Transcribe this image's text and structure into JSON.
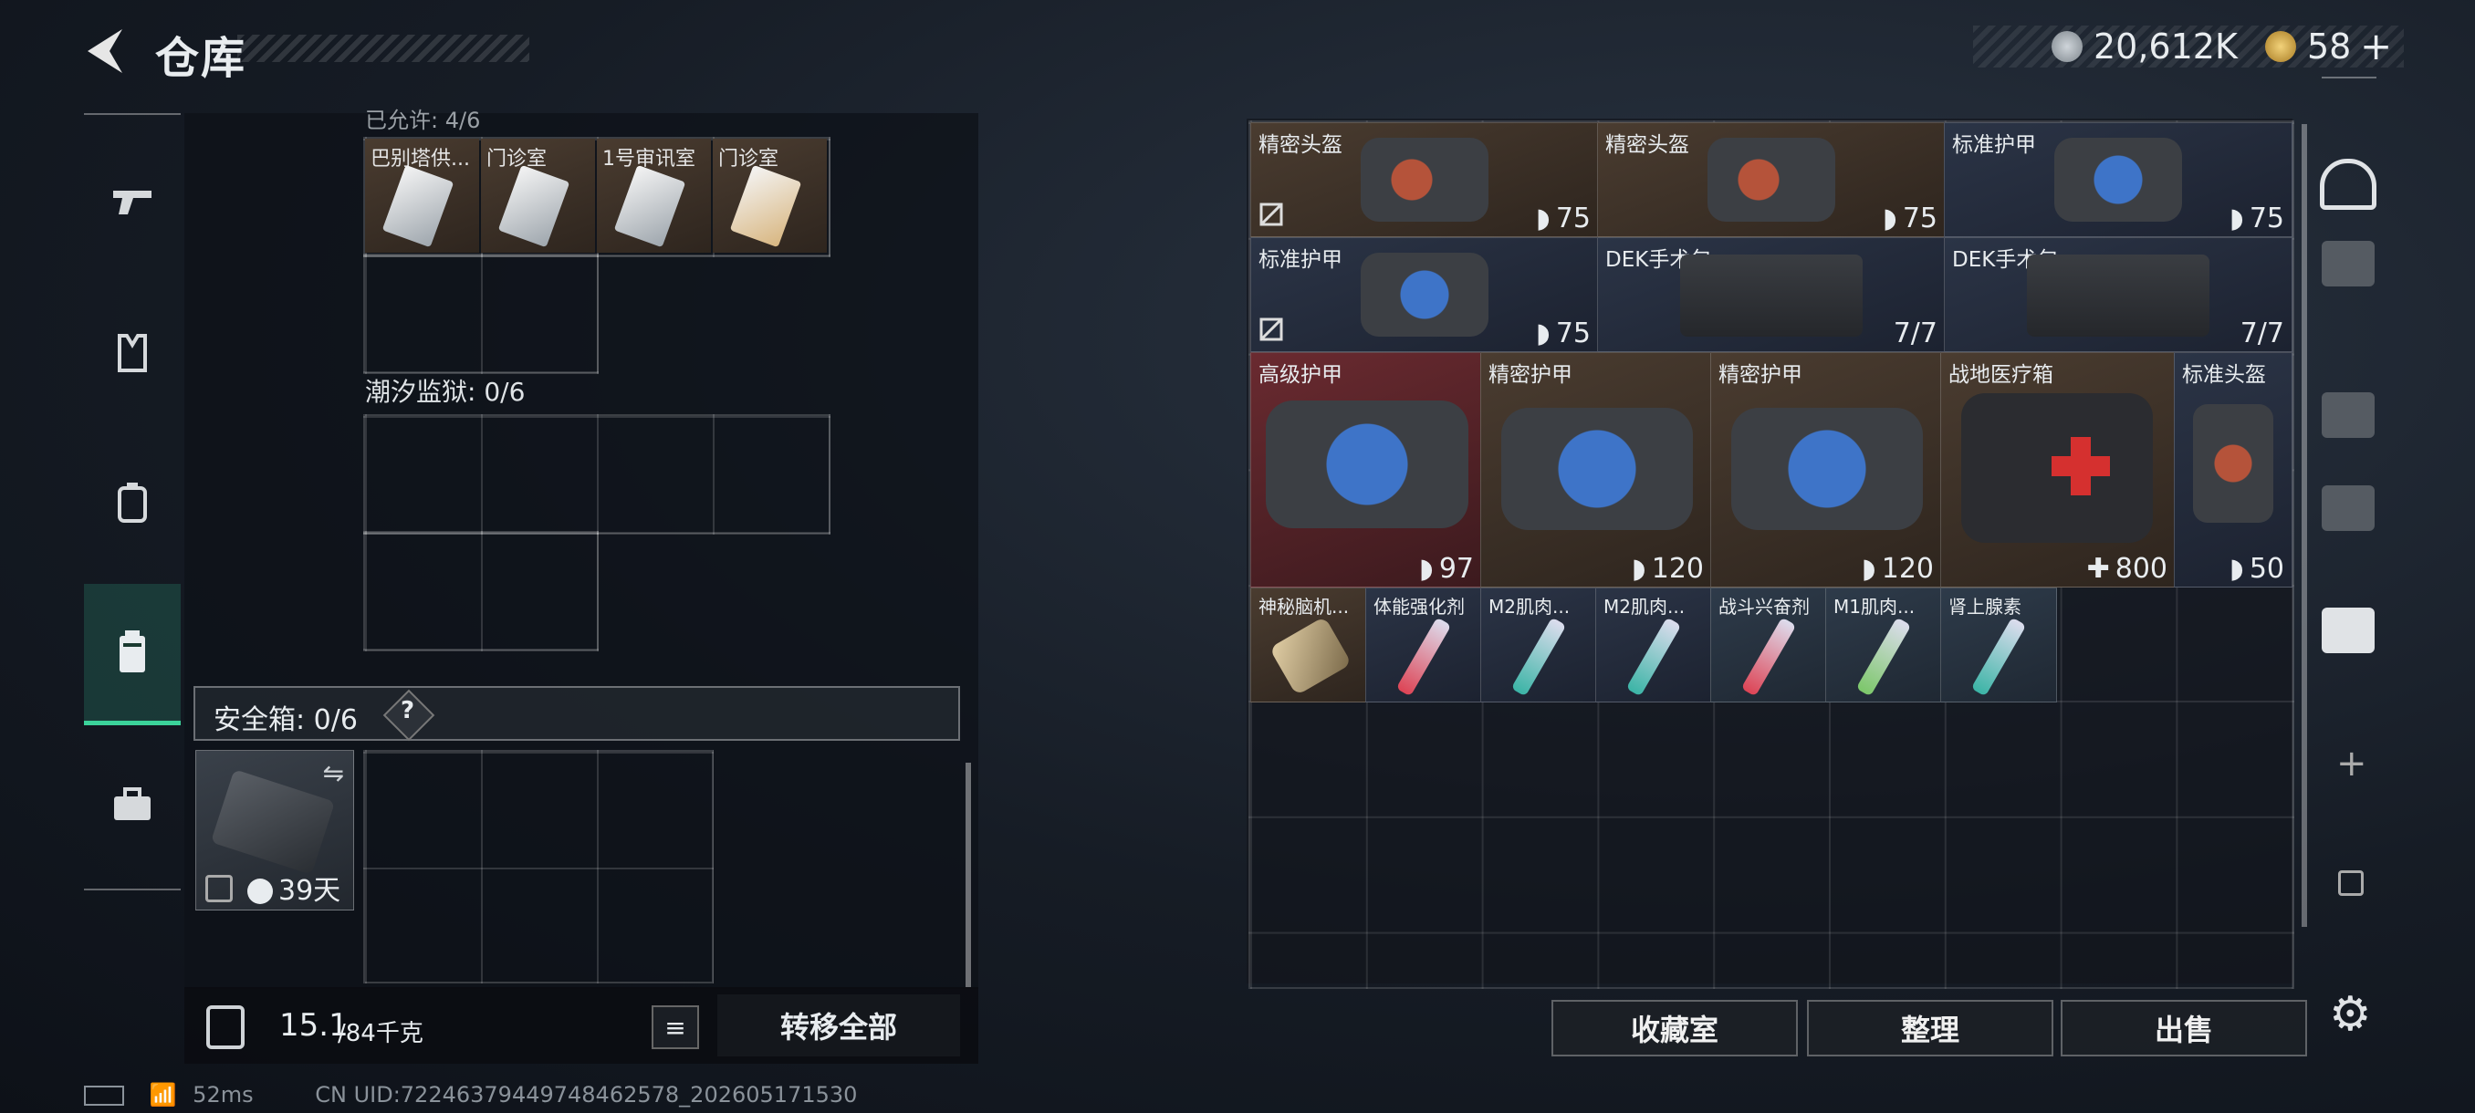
{
  "header": {
    "title": "仓库",
    "currency_silver": "20,612K",
    "currency_gold": "58",
    "plus_label": "+"
  },
  "left": {
    "top_text": "已允许: 4/6",
    "top_cells": [
      "巴别塔供...",
      "门诊室",
      "1号审讯室",
      "门诊室"
    ],
    "section2_label": "潮汐监狱: 0/6",
    "safe_label": "安全箱: 0/6",
    "safe_help": "?",
    "safe_days": "39天",
    "weight_main": "15.1",
    "weight_sub": "/84千克",
    "transfer_all": "转移全部"
  },
  "items": [
    {
      "label": "精密头盔",
      "value": "75",
      "kind": "shield"
    },
    {
      "label": "精密头盔",
      "value": "75",
      "kind": "shield"
    },
    {
      "label": "标准护甲",
      "value": "75",
      "kind": "shield"
    },
    {
      "label": "标准护甲",
      "value": "75",
      "kind": "shield"
    },
    {
      "label": "DEK手术包",
      "value": "7/7",
      "kind": "count"
    },
    {
      "label": "DEK手术包",
      "value": "7/7",
      "kind": "count"
    },
    {
      "label": "高级护甲",
      "value": "97",
      "kind": "shield"
    },
    {
      "label": "精密护甲",
      "value": "120",
      "kind": "shield"
    },
    {
      "label": "精密护甲",
      "value": "120",
      "kind": "shield"
    },
    {
      "label": "战地医疗箱",
      "value": "800",
      "kind": "heal"
    },
    {
      "label": "标准头盔",
      "value": "50",
      "kind": "shield"
    },
    {
      "label": "神秘脑机...",
      "value": "",
      "kind": "none"
    },
    {
      "label": "体能强化剂",
      "value": "",
      "kind": "none"
    },
    {
      "label": "M2肌肉...",
      "value": "",
      "kind": "none"
    },
    {
      "label": "M2肌肉...",
      "value": "",
      "kind": "none"
    },
    {
      "label": "战斗兴奋剂",
      "value": "",
      "kind": "none"
    },
    {
      "label": "M1肌肉...",
      "value": "",
      "kind": "none"
    },
    {
      "label": "肾上腺素",
      "value": "",
      "kind": "none"
    }
  ],
  "buttons": {
    "collection": "收藏室",
    "sort": "整理",
    "sell": "出售"
  },
  "status": {
    "ping": "52ms",
    "uid": "CN UID:72246379449748462578_202605171530"
  },
  "colors": {
    "accent": "#3bd39a",
    "bg": "#161c25"
  }
}
